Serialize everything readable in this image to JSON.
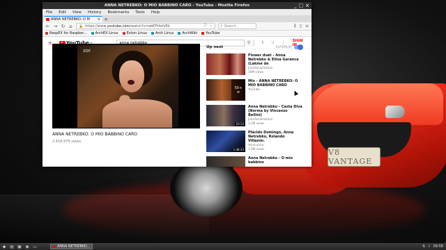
{
  "window": {
    "title": "ANNA NETREBKO: O MIO BABBINO CARO - YouTube - Mozilla Firefox",
    "controls": [
      "_",
      "□",
      "×"
    ]
  },
  "menubar": [
    "File",
    "Edit",
    "View",
    "History",
    "Bookmarks",
    "Tools",
    "Help"
  ],
  "tab": {
    "label": "ANNA NETREBKO: O M",
    "close": "×",
    "new_tab": "+"
  },
  "navbar": {
    "url_prefix": "https://www.",
    "url_host": "youtube.com",
    "url_path": "/watch?v=ebEFHetVRk",
    "search_placeholder": "Search"
  },
  "bookmarks": [
    {
      "label": "RaspEX for Raspber...",
      "color": "#c0392b"
    },
    {
      "label": "ArchEX Linux",
      "color": "#1793d1"
    },
    {
      "label": "Exton Linux",
      "color": "#c0392b"
    },
    {
      "label": "Arch Linux",
      "color": "#1793d1"
    },
    {
      "label": "ArchWiki",
      "color": "#1793d1"
    },
    {
      "label": "YouTube",
      "color": "#ff0000"
    }
  ],
  "youtube": {
    "logo_text": "YouTube",
    "logo_suffix": "SE",
    "search_value": "anna netrebko",
    "signin_label": "SIGN IN",
    "video_title": "ANNA NETREBKO: O MIO BABBINO CARO",
    "views": "2,418,979 views",
    "channel_watermark": "ZDF",
    "up_next_label": "Up next",
    "autoplay_label": "AUTOPLAY",
    "recommendations": [
      {
        "title": "Flower duet - Anna Netrebko & Elina Garanca (Lakmé de",
        "channel": "JuanSocialization",
        "views": "16M views",
        "duration": ""
      },
      {
        "title": "Mix - ANNA NETREBKO: O MIO BABBINO CARO",
        "channel": "YouTube",
        "views": "",
        "playlist": "50+"
      },
      {
        "title": "Anna Netrebko - Casta Diva (Norma by Vincenzo Bellini)",
        "channel": "JuanSocialization",
        "views": "3.2M views",
        "duration": "10:12"
      },
      {
        "title": "Plácido Domingo, Anna Netrebko, Rolando Villazón.",
        "channel": "Veracuima",
        "views": "1.9M views",
        "duration": "1:48:33"
      },
      {
        "title": "Anna Netrebko - O mio babbino",
        "channel": "",
        "views": "",
        "duration": ""
      }
    ]
  },
  "wallpaper": {
    "plate_text": "V8 VANTAGE"
  },
  "taskbar": {
    "task_label": "ANNA NETREBKO...",
    "clock": "09:58"
  }
}
